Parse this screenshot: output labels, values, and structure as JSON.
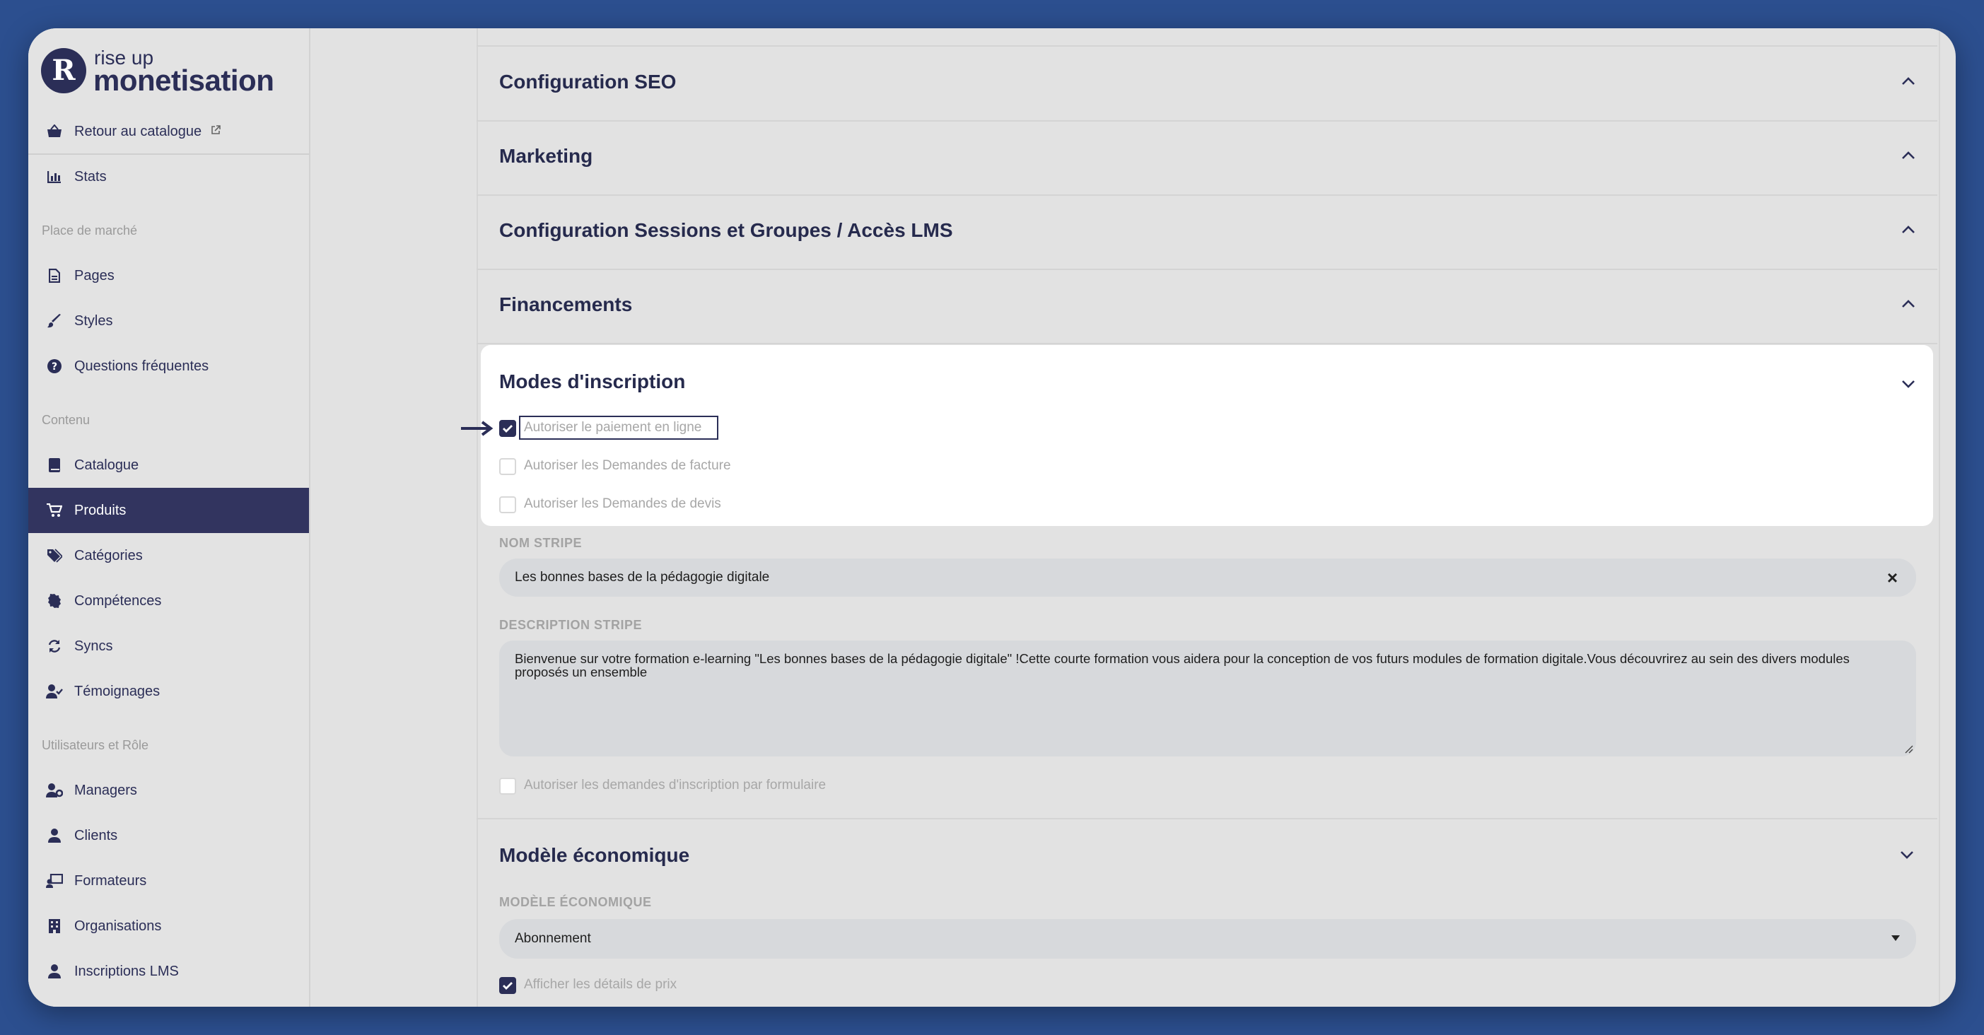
{
  "logo": {
    "mark": "R",
    "top": "rise up",
    "bottom": "monetisation"
  },
  "sidebar": {
    "top_items": [
      {
        "label": "Retour au catalogue",
        "icon": "basket-icon",
        "external_icon": "external-link-icon"
      },
      {
        "label": "Stats",
        "icon": "chart-icon"
      }
    ],
    "sections": [
      {
        "title": "Place de marché",
        "items": [
          {
            "label": "Pages",
            "icon": "page-icon"
          },
          {
            "label": "Styles",
            "icon": "brush-icon"
          },
          {
            "label": "Questions fréquentes",
            "icon": "question-icon"
          }
        ]
      },
      {
        "title": "Contenu",
        "items": [
          {
            "label": "Catalogue",
            "icon": "book-icon"
          },
          {
            "label": "Produits",
            "icon": "cart-icon",
            "active": true
          },
          {
            "label": "Catégories",
            "icon": "tags-icon"
          },
          {
            "label": "Compétences",
            "icon": "badge-icon"
          },
          {
            "label": "Syncs",
            "icon": "sync-icon"
          },
          {
            "label": "Témoignages",
            "icon": "user-check-icon"
          }
        ]
      },
      {
        "title": "Utilisateurs et Rôle",
        "items": [
          {
            "label": "Managers",
            "icon": "user-gear-icon"
          },
          {
            "label": "Clients",
            "icon": "user-icon"
          },
          {
            "label": "Formateurs",
            "icon": "teacher-icon"
          },
          {
            "label": "Organisations",
            "icon": "building-icon"
          },
          {
            "label": "Inscriptions LMS",
            "icon": "user-icon"
          }
        ]
      }
    ]
  },
  "accordions": [
    {
      "title": "Configuration SEO"
    },
    {
      "title": "Marketing"
    },
    {
      "title": "Configuration Sessions et Groupes / Accès LMS"
    },
    {
      "title": "Financements"
    }
  ],
  "modes": {
    "title": "Modes d'inscription",
    "options": [
      {
        "label": "Autoriser le paiement en ligne",
        "checked": true
      },
      {
        "label": "Autoriser les Demandes de facture",
        "checked": false
      },
      {
        "label": "Autoriser les Demandes de devis",
        "checked": false
      }
    ],
    "nom_stripe_label": "NOM STRIPE",
    "nom_stripe_value": "Les bonnes bases de la pédagogie digitale",
    "clear_glyph": "×",
    "description_label": "DESCRIPTION STRIPE",
    "description_value": "Bienvenue sur votre formation e-learning \"Les bonnes bases de la pédagogie digitale\" !Cette courte formation vous aidera pour la conception de vos futurs modules de formation digitale.Vous découvrirez au sein des divers modules proposés un ensemble",
    "form_option": {
      "label": "Autoriser les demandes d'inscription par formulaire",
      "checked": false
    }
  },
  "modele": {
    "title": "Modèle économique",
    "field_label": "MODÈLE ÉCONOMIQUE",
    "selected": "Abonnement",
    "price_option": {
      "label": "Afficher les détails de prix",
      "checked": true
    }
  },
  "colors": {
    "background": "#2c4f8f",
    "brand": "#2b2e57",
    "active_nav": "#32345f"
  }
}
